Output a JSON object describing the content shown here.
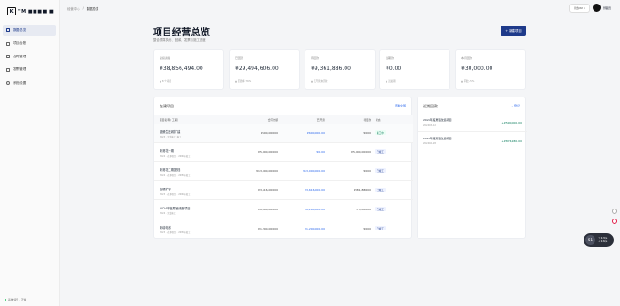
{
  "brand": {
    "name": "\"M ■■■■ ■"
  },
  "sidebar": {
    "items": [
      {
        "label": "数据总览",
        "icon": "grid-icon",
        "active": true
      },
      {
        "label": "项目台账"
      },
      {
        "label": "合同管理"
      },
      {
        "label": "发票管理"
      },
      {
        "label": "系统设置"
      }
    ],
    "footer": "系统运行 · 正常"
  },
  "topbar": {
    "crumbs": [
      "经营中心",
      "/",
      "数据总览"
    ],
    "export_label": "导出Ctrl K",
    "user_name": "管理员"
  },
  "header": {
    "title": "项目经营总览",
    "subtitle": "整合预算执行、回款、发票与施工进度",
    "new_button": "+ 新建项目"
  },
  "cards": [
    {
      "label": "总投资额",
      "value": "¥38,856,494.00",
      "note": "▲ 8 个项目"
    },
    {
      "label": "已回款",
      "value": "¥29,494,606.00",
      "note": "▲ 回款率 76%"
    },
    {
      "label": "待回款",
      "value": "¥9,361,886.00",
      "note": "▲ 已开票未回款"
    },
    {
      "label": "逾期款",
      "value": "¥0.00",
      "note": "▲ 无逾期"
    },
    {
      "label": "本月回款",
      "value": "¥30,000.00",
      "note": "▲ 同比+5%"
    }
  ],
  "projects": {
    "title": "在建项目",
    "link": "查看全部",
    "columns": [
      "项目名称 / 工期",
      "合同金额",
      "已开票",
      "待回款",
      "状态"
    ],
    "rows": [
      {
        "name": "健朗生医城扩建",
        "sub": "2023 · 完成施工 施工",
        "budget": "¥600,000.00",
        "invoiced": "¥600,000.00",
        "pending": "¥0.00",
        "status": "施工中",
        "done": true
      },
      {
        "name": "新港花一期",
        "sub": "2024 · 在建项目 · 2024年竣工",
        "budget": "¥5,800,000.00",
        "invoiced": "¥0.00",
        "pending": "¥5,800,000.00",
        "status": "已竣工",
        "done": false
      },
      {
        "name": "新港花二期提档",
        "sub": "2024 · 在建项目 · 2025年竣工",
        "budget": "¥13,000,000.00",
        "invoiced": "¥13,000,000.00",
        "pending": "¥0.00",
        "status": "已竣工",
        "done": false
      },
      {
        "name": "启顺扩容",
        "sub": "2023 · 在建项目 · 2024年竣工",
        "budget": "¥3,616,000.00",
        "invoiced": "¥3,616,000.00",
        "pending": "¥381,886.00",
        "status": "已竣工",
        "done": false
      },
      {
        "name": "2024年度屋面改造项目",
        "sub": "2024 · 完成施工",
        "budget": "¥8,500,000.00",
        "invoiced": "¥8,290,000.00",
        "pending": "¥73,000.00",
        "status": "已竣工",
        "done": false
      },
      {
        "name": "新增电梯",
        "sub": "2023 · 在建项目 · 2023年竣工",
        "budget": "¥1,200,000.00",
        "invoiced": "¥1,200,000.00",
        "pending": "¥0.00",
        "status": "已竣工",
        "done": false
      }
    ]
  },
  "recent": {
    "title": "近期回款",
    "link": "+ 登记",
    "items": [
      {
        "name": "2024年度屋面改造项目",
        "date": "2024-03-12",
        "amount": "+¥590,000.00"
      },
      {
        "name": "2024年度屋面改造项目",
        "date": "2024-02-28",
        "amount": "+¥874,180.00"
      }
    ]
  },
  "widget": {
    "num": "51",
    "line1": "↑ 0.3K/s",
    "line2": "↓ 0.6K/s"
  },
  "colors": {
    "accent": "#1e3a8a",
    "positive": "#047857",
    "link": "#2563eb"
  }
}
